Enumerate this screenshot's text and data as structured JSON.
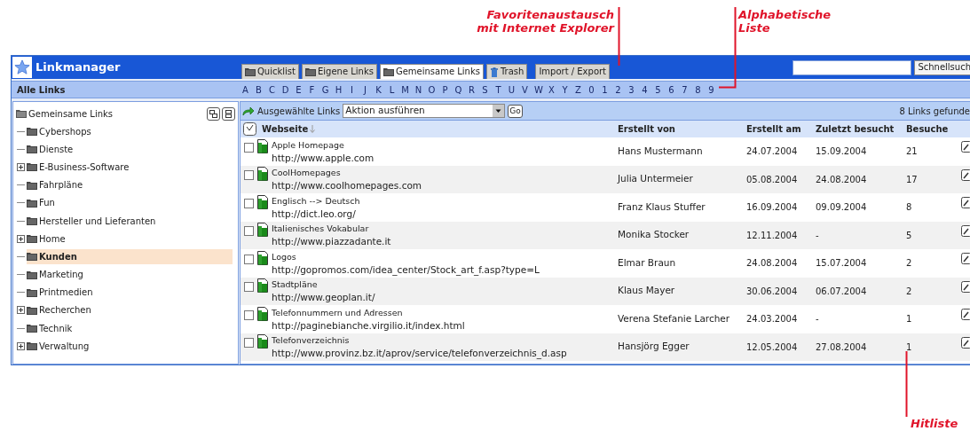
{
  "annotations": [
    {
      "lines": [
        "Favoritenaustausch",
        "mit Internet Explorer"
      ]
    },
    {
      "lines": [
        "Alphabetische",
        "Liste"
      ]
    },
    {
      "lines": [
        "Hitliste"
      ]
    }
  ],
  "app": {
    "title": "Linkmanager",
    "tabs": [
      {
        "label": "Quicklist",
        "kind": "folder",
        "selected": false
      },
      {
        "label": "Eigene Links",
        "kind": "folder",
        "selected": false
      },
      {
        "label": "Gemeinsame Links",
        "kind": "folder",
        "selected": true
      },
      {
        "label": "Trash",
        "kind": "trash",
        "selected": false
      },
      {
        "label": "Import / Export",
        "kind": "plain",
        "selected": false
      }
    ],
    "search_button": "Schnellsuch"
  },
  "alphabet_bar": {
    "label": "Alle Links",
    "letters": [
      "A",
      "B",
      "C",
      "D",
      "E",
      "F",
      "G",
      "H",
      "I",
      "J",
      "K",
      "L",
      "M",
      "N",
      "O",
      "P",
      "Q",
      "R",
      "S",
      "T",
      "U",
      "V",
      "W",
      "X",
      "Y",
      "Z",
      "0",
      "1",
      "2",
      "3",
      "4",
      "5",
      "6",
      "7",
      "8",
      "9"
    ]
  },
  "tree": {
    "root": "Gemeinsame Links",
    "items": [
      {
        "label": "Cybershops",
        "kind": "leaf",
        "selected": false
      },
      {
        "label": "Dienste",
        "kind": "leaf",
        "selected": false
      },
      {
        "label": "E-Business-Software",
        "kind": "branch",
        "selected": false
      },
      {
        "label": "Fahrpläne",
        "kind": "leaf",
        "selected": false
      },
      {
        "label": "Fun",
        "kind": "leaf",
        "selected": false
      },
      {
        "label": "Hersteller und Lieferanten",
        "kind": "leaf",
        "selected": false
      },
      {
        "label": "Home",
        "kind": "branch",
        "selected": false
      },
      {
        "label": "Kunden",
        "kind": "leaf",
        "selected": true
      },
      {
        "label": "Marketing",
        "kind": "leaf",
        "selected": false
      },
      {
        "label": "Printmedien",
        "kind": "leaf",
        "selected": false
      },
      {
        "label": "Recherchen",
        "kind": "branch",
        "selected": false
      },
      {
        "label": "Technik",
        "kind": "leaf",
        "selected": false
      },
      {
        "label": "Verwaltung",
        "kind": "branch",
        "selected": false
      }
    ]
  },
  "toolbar": {
    "label": "Ausgewählte Links",
    "action": "Aktion ausführen",
    "go": "Go",
    "count": "8 Links gefunde"
  },
  "table": {
    "columns": [
      "Webseite",
      "Erstellt von",
      "Erstellt am",
      "Zuletzt besucht",
      "Besuche"
    ],
    "rows": [
      {
        "checked": false,
        "title": "Apple Homepage",
        "url": "http://www.apple.com",
        "creator": "Hans Mustermann",
        "created": "24.07.2004",
        "visited": "15.09.2004",
        "visits": "21"
      },
      {
        "checked": false,
        "title": "CoolHomepages",
        "url": "http://www.coolhomepages.com",
        "creator": "Julia Untermeier",
        "created": "05.08.2004",
        "visited": "24.08.2004",
        "visits": "17"
      },
      {
        "checked": false,
        "title": "Englisch --> Deutsch",
        "url": "http://dict.leo.org/",
        "creator": "Franz Klaus Stuffer",
        "created": "16.09.2004",
        "visited": "09.09.2004",
        "visits": "8"
      },
      {
        "checked": false,
        "title": "Italienisches Vokabular",
        "url": "http://www.piazzadante.it",
        "creator": "Monika Stocker",
        "created": "12.11.2004",
        "visited": "-",
        "visits": "5"
      },
      {
        "checked": false,
        "title": "Logos",
        "url": "http://gopromos.com/idea_center/Stock_art_f.asp?type=L",
        "creator": "Elmar Braun",
        "created": "24.08.2004",
        "visited": "15.07.2004",
        "visits": "2"
      },
      {
        "checked": false,
        "title": "Stadtpläne",
        "url": "http://www.geoplan.it/",
        "creator": "Klaus Mayer",
        "created": "30.06.2004",
        "visited": "06.07.2004",
        "visits": "2"
      },
      {
        "checked": false,
        "title": "Telefonnummern und Adressen",
        "url": "http://paginebianche.virgilio.it/index.html",
        "creator": "Verena Stefanie Larcher",
        "created": "24.03.2004",
        "visited": "-",
        "visits": "1"
      },
      {
        "checked": false,
        "title": "Telefonverzeichnis",
        "url": "http://www.provinz.bz.it/aprov/service/telefonverzeichnis_d.asp",
        "creator": "Hansjörg Egger",
        "created": "12.05.2004",
        "visited": "27.08.2004",
        "visits": "1"
      }
    ]
  }
}
